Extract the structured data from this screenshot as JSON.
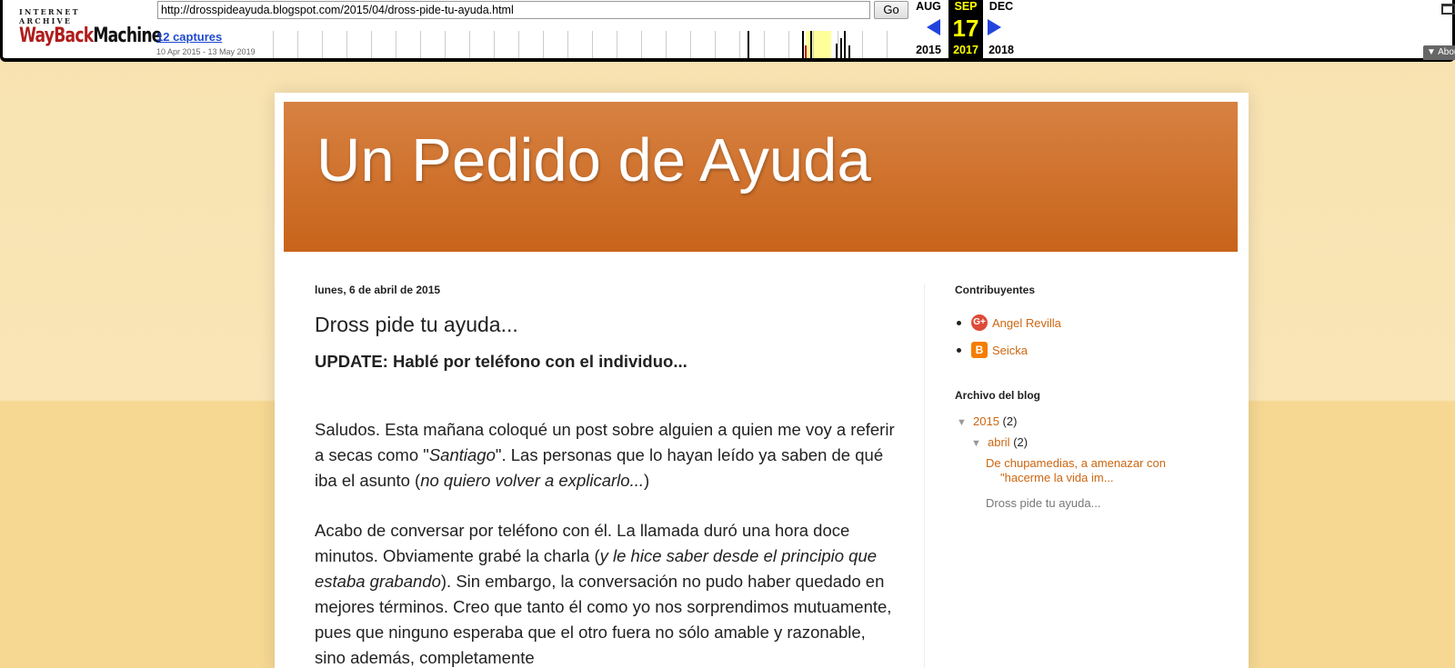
{
  "wayback": {
    "logo_top": "INTERNET ARCHIVE",
    "logo_way": "WayBack",
    "logo_machine": "Machine",
    "url": "http://drosspideayuda.blogspot.com/2015/04/dross-pide-tu-ayuda.html",
    "go_label": "Go",
    "captures_label": "12 captures",
    "date_range": "10 Apr 2015 - 13 May 2019",
    "prev": {
      "month": "AUG",
      "year": "2015"
    },
    "current": {
      "month": "SEP",
      "day": "17",
      "year": "2017"
    },
    "next": {
      "month": "DEC",
      "year": "2018"
    },
    "about_label": "▼ About"
  },
  "blog": {
    "title": "Un Pedido de Ayuda",
    "post": {
      "date": "lunes, 6 de abril de 2015",
      "title": "Dross pide tu ayuda...",
      "update": "UPDATE: Hablé por teléfono con el individuo...",
      "p1_a": "Saludos. Esta mañana coloqué un post sobre alguien a quien me voy a referir a secas como \"",
      "p1_em1": "Santiago",
      "p1_b": "\". Las personas que lo hayan leído ya saben de qué iba el asunto (",
      "p1_em2": "no quiero volver a explicarlo...",
      "p1_c": ")",
      "p2_a": "Acabo de conversar por teléfono con él. La llamada duró una hora doce minutos. Obviamente grabé la charla (",
      "p2_em": "y le hice saber desde el principio que estaba grabando",
      "p2_b": "). Sin embargo, la conversación no pudo haber quedado en mejores términos. Creo que tanto él como yo nos sorprendimos mutuamente, pues que ninguno esperaba que el otro fuera no sólo amable y razonable, sino además, completamente"
    },
    "sidebar": {
      "contributors_title": "Contribuyentes",
      "contributors": [
        {
          "name": "Angel Revilla",
          "icon": "google-plus-icon"
        },
        {
          "name": "Seicka",
          "icon": "blogger-icon"
        }
      ],
      "archive_title": "Archivo del blog",
      "year": "2015",
      "year_count": "(2)",
      "month": "abril",
      "month_count": "(2)",
      "post1_line1": "De chupamedias, a amenazar con",
      "post1_line2": "\"hacerme la vida im...",
      "post2": "Dross pide tu ayuda..."
    }
  },
  "colors": {
    "header_top": "#d78142",
    "header_bottom": "#c8641a",
    "link": "#cc6611",
    "background": "#f8e2b0"
  }
}
